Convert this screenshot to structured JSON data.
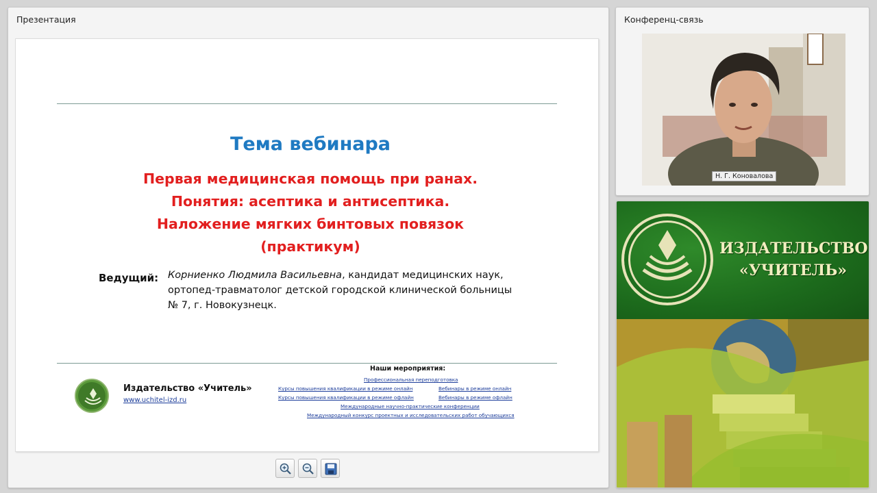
{
  "presentation": {
    "title": "Презентация",
    "slide": {
      "heading": "Тема вебинара",
      "topic_lines": [
        "Первая медицинская помощь при ранах.",
        "Понятия: асептика и антисептика.",
        "Наложение мягких бинтовых повязок",
        "(практикум)"
      ],
      "host_label": "Ведущий:",
      "host_name": "Корниенко Людмила Васильевна",
      "host_desc_1": ", кандидат медицинских наук,",
      "host_desc_2": "ортопед-травматолог детской городской клинической больницы",
      "host_desc_3": "№ 7, г. Новокузнецк.",
      "publisher_name": "Издательство «Учитель»",
      "publisher_url": "www.uchitel-izd.ru",
      "events_title": "Наши мероприятия:",
      "events": [
        "Профессиональная переподготовка",
        "Курсы повышения квалификации в режиме онлайн",
        "Вебинары в режиме онлайн",
        "Курсы повышения квалификации в режиме офлайн",
        "Вебинары в режиме офлайн",
        "Международные научно-практические конференции",
        "Международный конкурс проектных и исследовательских работ обучающихся"
      ]
    },
    "toolbar": {
      "zoom_in": "zoom-in-icon",
      "zoom_out": "zoom-out-icon",
      "save": "save-icon"
    }
  },
  "conference": {
    "title": "Конференц-связь",
    "participant_name": "Н. Г. Коновалова"
  },
  "banner": {
    "line1": "ИЗДАТЕЛЬСТВО",
    "line2": "«УЧИТЕЛЬ»"
  },
  "colors": {
    "heading_blue": "#1f7ac2",
    "topic_red": "#e21f1f",
    "brand_green": "#1c6a1c",
    "link_blue": "#1b3c9a"
  }
}
